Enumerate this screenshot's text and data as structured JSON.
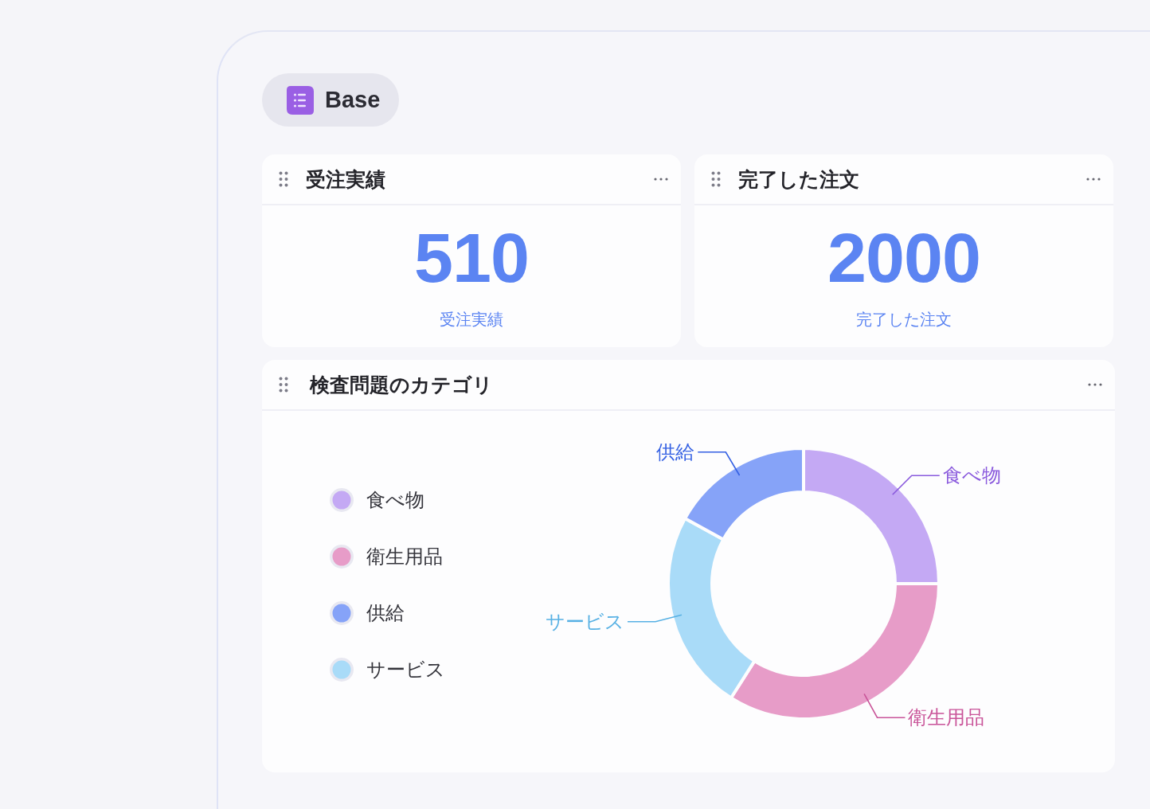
{
  "app_badge": {
    "label": "Base"
  },
  "stat_cards": [
    {
      "title": "受注実績",
      "value": "510",
      "caption": "受注実績"
    },
    {
      "title": "完了した注文",
      "value": "2000",
      "caption": "完了した注文"
    }
  ],
  "chart_card": {
    "title": "検査問題のカテゴリ",
    "legend": [
      {
        "label": "食べ物",
        "color": "#c4a9f4"
      },
      {
        "label": "衛生用品",
        "color": "#e79cc8"
      },
      {
        "label": "供給",
        "color": "#86a3f8"
      },
      {
        "label": "サービス",
        "color": "#a9dbf8"
      }
    ],
    "chart_data": [
      {
        "type": "donut",
        "categories": [
          "食べ物",
          "衛生用品",
          "サービス",
          "供給"
        ],
        "values": [
          25,
          34,
          24,
          17
        ],
        "colors": [
          "#c4a9f4",
          "#e79cc8",
          "#a9dbf8",
          "#86a3f8"
        ]
      }
    ]
  }
}
